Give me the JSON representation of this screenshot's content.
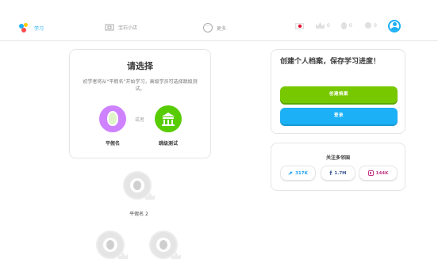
{
  "nav": {
    "learn_label": "学习",
    "stories_label": "宝石小店",
    "more_label": "更多"
  },
  "stats": {
    "streak": "0",
    "gems": "0",
    "hearts": "0"
  },
  "choose": {
    "title": "请选择",
    "description": "初学者将从“平假名”开始学习，高级学员可选择跳级测试。",
    "option_a_label": "平假名",
    "or_label": "或者",
    "option_b_label": "跳级测试"
  },
  "path": {
    "node_label": "平假名 2"
  },
  "profile": {
    "title": "创建个人档案，保存学习进度！",
    "create_label": "创建档案",
    "login_label": "登录"
  },
  "social": {
    "title": "关注多邻国",
    "twitter_count": "317K",
    "facebook_count": "1.7M",
    "instagram_count": "144K"
  },
  "colors": {
    "accent_blue": "#1cb0f6",
    "accent_green": "#58cc02",
    "purple": "#ce82ff",
    "create_button": "#78c800"
  }
}
